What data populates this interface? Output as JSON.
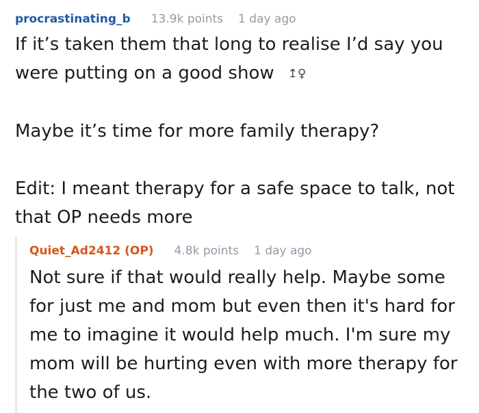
{
  "comments": [
    {
      "author": "procrastinating_b",
      "points": "13.9k points",
      "time": "1 day ago",
      "paragraphs": [
        "If it’s taken them that long to realise I’d say you were putting on a good show",
        "Maybe it’s time for more family therapy?",
        "Edit: I meant therapy for a safe space to talk, not that OP needs more"
      ],
      "emoji": "🤷‍♀️",
      "emoji_fallback": "↥♀"
    },
    {
      "author": "Quiet_Ad2412 (OP)",
      "points": "4.8k points",
      "time": "1 day ago",
      "paragraphs": [
        "Not sure if that would really help. Maybe some for just me and mom but even then it's hard for me to imagine it would help much. I'm sure my mom will be hurting even with more therapy for the two of us."
      ]
    }
  ],
  "colors": {
    "author_link": "#1f5aa6",
    "op_author": "#d9541a",
    "meta_gray": "#8f9ba5",
    "body_text": "#1c1c1c",
    "thread_line": "#e8e8e8"
  }
}
